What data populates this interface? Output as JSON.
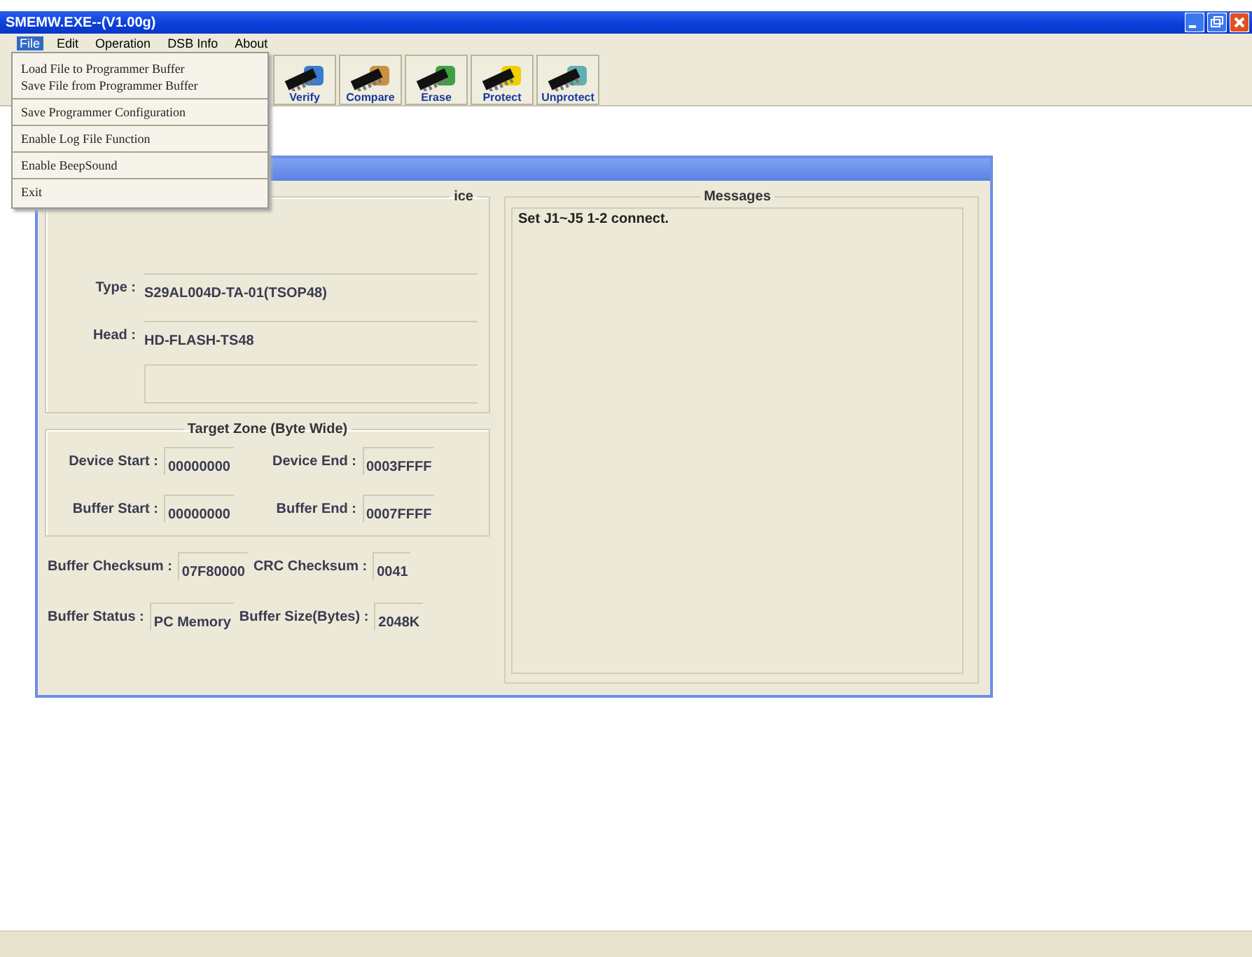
{
  "window": {
    "title": "SMEMW.EXE--(V1.00g)"
  },
  "menu": [
    {
      "label": "File",
      "selected": true
    },
    {
      "label": "Edit",
      "selected": false
    },
    {
      "label": "Operation",
      "selected": false
    },
    {
      "label": "DSB Info",
      "selected": false
    },
    {
      "label": "About",
      "selected": false
    }
  ],
  "file_menu": [
    [
      "Load File to Programmer Buffer",
      "Save File from Programmer Buffer"
    ],
    [
      "Save Programmer Configuration"
    ],
    [
      "Enable Log File Function"
    ],
    [
      "Enable BeepSound"
    ],
    [
      "Exit"
    ]
  ],
  "toolbar": [
    {
      "label": "Verify",
      "kind": "verify"
    },
    {
      "label": "Compare",
      "kind": "compare"
    },
    {
      "label": "Erase",
      "kind": "erase"
    },
    {
      "label": "Protect",
      "kind": "protect"
    },
    {
      "label": "Unprotect",
      "kind": "unprotect"
    }
  ],
  "device": {
    "title": "ice",
    "type_label": "Type :",
    "type": "S29AL004D-TA-01(TSOP48)",
    "head_label": "Head :",
    "head": "HD-FLASH-TS48"
  },
  "target_zone": {
    "title": "Target Zone (Byte Wide)",
    "rows": [
      [
        {
          "label": "Device Start :",
          "value": "00000000"
        },
        {
          "label": "Device End :",
          "value": "0003FFFF"
        }
      ],
      [
        {
          "label": "Buffer Start :",
          "value": "00000000"
        },
        {
          "label": "Buffer End :",
          "value": "0007FFFF"
        }
      ]
    ]
  },
  "info_rows": [
    [
      {
        "label": "Buffer Checksum :",
        "value": "07F80000"
      },
      {
        "label": "CRC Checksum :",
        "value": "0041"
      }
    ],
    [
      {
        "label": "Buffer Status :",
        "value": "PC Memory"
      },
      {
        "label": "Buffer Size(Bytes) :",
        "value": "2048K"
      }
    ]
  ],
  "messages": {
    "title": "Messages",
    "lines": [
      "Set J1~J5 1-2 connect."
    ]
  }
}
